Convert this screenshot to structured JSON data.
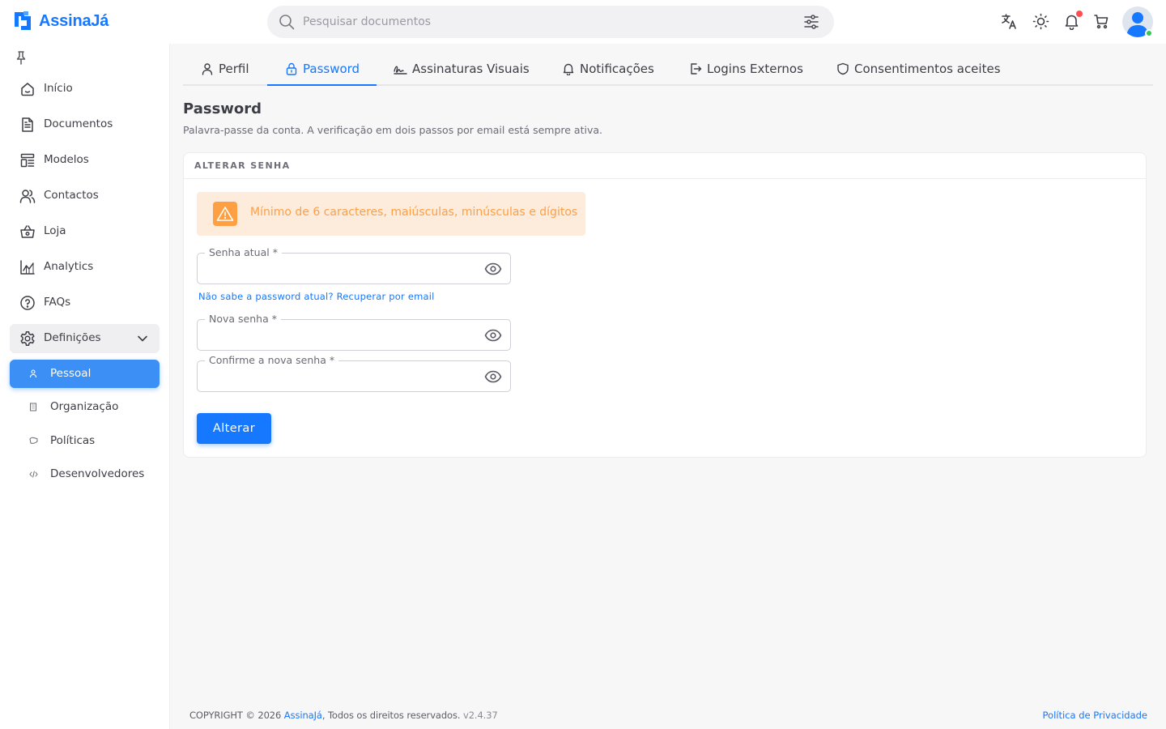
{
  "brand": {
    "name": "AssinaJá",
    "color": "#1677ff"
  },
  "search": {
    "placeholder": "Pesquisar documentos"
  },
  "header_icons": [
    "translate-icon",
    "sun-icon",
    "bell-icon",
    "cart-icon"
  ],
  "sidebar": {
    "items": [
      {
        "label": "Início",
        "icon": "home-icon"
      },
      {
        "label": "Documentos",
        "icon": "document-icon"
      },
      {
        "label": "Modelos",
        "icon": "template-icon"
      },
      {
        "label": "Contactos",
        "icon": "users-icon"
      },
      {
        "label": "Loja",
        "icon": "basket-icon"
      },
      {
        "label": "Analytics",
        "icon": "chart-icon"
      },
      {
        "label": "FAQs",
        "icon": "help-icon"
      }
    ],
    "group": {
      "label": "Definições",
      "icon": "settings-icon",
      "expanded": true
    },
    "sub_items": [
      {
        "label": "Pessoal",
        "active": true
      },
      {
        "label": "Organização",
        "active": false
      },
      {
        "label": "Políticas",
        "active": false
      },
      {
        "label": "Desenvolvedores",
        "active": false
      }
    ]
  },
  "tabs": [
    {
      "label": "Perfil",
      "icon": "user-icon"
    },
    {
      "label": "Password",
      "icon": "lock-icon",
      "active": true
    },
    {
      "label": "Assinaturas Visuais",
      "icon": "signature-icon"
    },
    {
      "label": "Notificações",
      "icon": "bell-icon"
    },
    {
      "label": "Logins Externos",
      "icon": "login-icon"
    },
    {
      "label": "Consentimentos aceites",
      "icon": "shield-icon"
    }
  ],
  "page": {
    "title": "Password",
    "subtitle": "Palavra-passe da conta. A verificação em dois passos por email está sempre ativa."
  },
  "card": {
    "title": "ALTERAR SENHA",
    "alert": "Mínimo de 6 caracteres, maiúsculas, minúsculas e dígitos",
    "fields": {
      "current": {
        "label": "Senha atual",
        "value": ""
      },
      "new": {
        "label": "Nova senha",
        "value": ""
      },
      "confirm": {
        "label": "Confirme a nova senha",
        "value": ""
      }
    },
    "recover_link": "Não sabe a password atual? Recuperar por email",
    "submit_label": "Alterar"
  },
  "footer": {
    "copyright_prefix": "COPYRIGHT © 2026 ",
    "brand": "AssinaJá",
    "rights": ", Todos os direitos reservados. ",
    "version": "v2.4.37",
    "privacy": "Política de Privacidade"
  },
  "colors": {
    "accent": "#1677ff",
    "warning": "#ff9f43",
    "warning_bg": "#fdebdc",
    "online": "#34c759"
  }
}
